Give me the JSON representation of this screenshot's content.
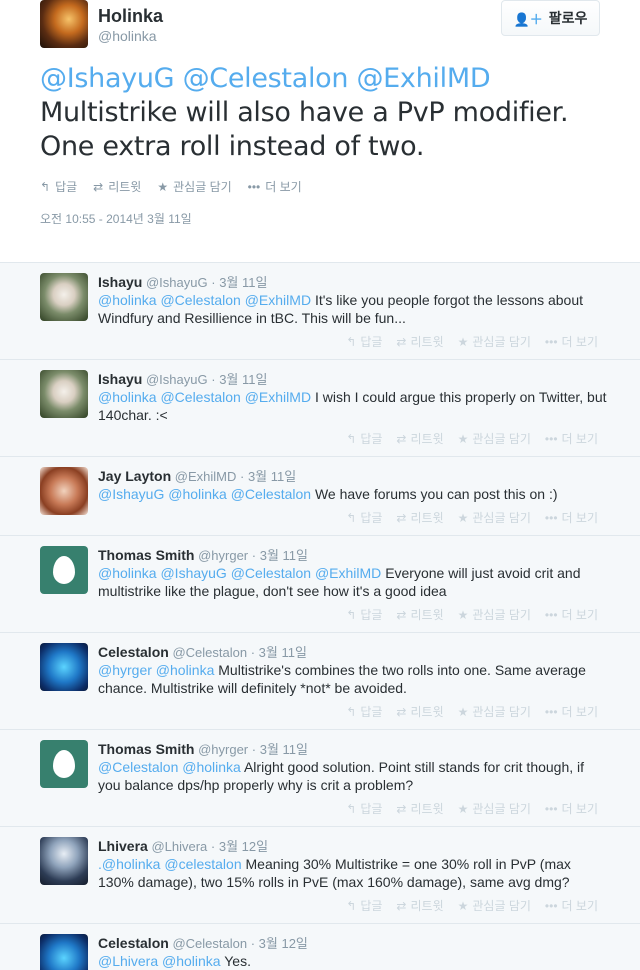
{
  "main_tweet": {
    "name": "Holinka",
    "handle": "@holinka",
    "follow_label": "팔로우",
    "mentions": "@IshayuG @Celestalon @ExhilMD",
    "text_line1": "Multistrike will also have a PvP modifier.",
    "text_line2": "One extra roll instead of two.",
    "actions": {
      "reply": "답글",
      "retweet": "리트윗",
      "favorite": "관심글 담기",
      "more": "더 보기"
    },
    "timestamp": "오전 10:55 - 2014년 3월 11일"
  },
  "reply_actions": {
    "reply": "답글",
    "retweet": "리트윗",
    "favorite": "관심글 담기",
    "more": "더 보기"
  },
  "replies": [
    {
      "name": "Ishayu",
      "handle": "@IshayuG",
      "date": "3월 11일",
      "mentions": "@holinka @Celestalon @ExhilMD",
      "text": "It's like you people forgot the lessons about Windfury and Resillience in tBC. This will be fun..."
    },
    {
      "name": "Ishayu",
      "handle": "@IshayuG",
      "date": "3월 11일",
      "mentions": "@holinka @Celestalon @ExhilMD",
      "text": "I wish I could argue this properly on Twitter, but 140char. :<"
    },
    {
      "name": "Jay Layton",
      "handle": "@ExhilMD",
      "date": "3월 11일",
      "mentions": "@IshayuG @holinka @Celestalon",
      "text": "We have forums you can post this on :)"
    },
    {
      "name": "Thomas Smith",
      "handle": "@hyrger",
      "date": "3월 11일",
      "mentions": "@holinka @IshayuG @Celestalon @ExhilMD",
      "text": "Everyone will just avoid crit and multistrike like the plague, don't see how it's a good idea"
    },
    {
      "name": "Celestalon",
      "handle": "@Celestalon",
      "date": "3월 11일",
      "mentions": "@hyrger @holinka",
      "text": "Multistrike's combines the two rolls into one. Same average chance. Multistrike will definitely *not* be avoided."
    },
    {
      "name": "Thomas Smith",
      "handle": "@hyrger",
      "date": "3월 11일",
      "mentions": "@Celestalon @holinka",
      "text": "Alright good solution. Point still stands for crit though, if you balance dps/hp properly why is crit a problem?"
    },
    {
      "name": "Lhivera",
      "handle": "@Lhivera",
      "date": "3월 12일",
      "mentions": ".@holinka @celestalon",
      "text": "Meaning 30% Multistrike = one 30% roll in PvP (max 130% damage), two 15% rolls in PvE (max 160% damage), same avg dmg?"
    },
    {
      "name": "Celestalon",
      "handle": "@Celestalon",
      "date": "3월 12일",
      "mentions": "@Lhivera @holinka",
      "text": "Yes."
    }
  ],
  "colors": {
    "link": "#55acee",
    "muted": "#8899a6",
    "action": "#ccd6dd"
  }
}
